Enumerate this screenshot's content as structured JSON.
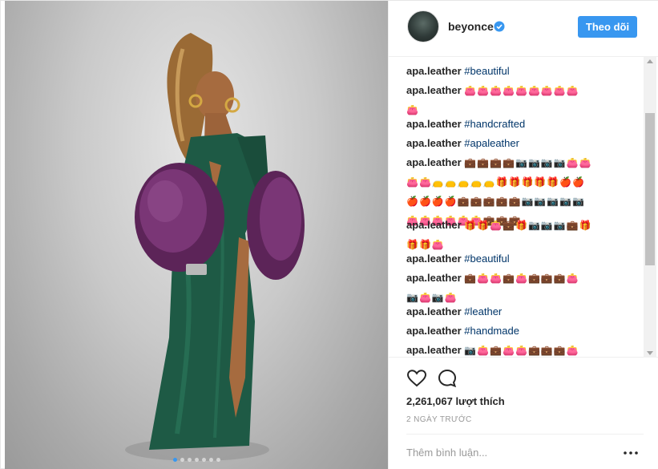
{
  "post": {
    "username": "beyonce",
    "follow_label": "Theo dõi",
    "likes": "2,261,067 lượt thích",
    "time": "2 NGÀY TRƯỚC",
    "comment_placeholder": "Thêm bình luận..."
  },
  "comments": [
    {
      "user": "apa.leather",
      "text": "#beautiful"
    },
    {
      "user": "apa.leather",
      "text": "👛👛👛👛👛👛👛👛👛",
      "text2": "👛"
    },
    {
      "user": "apa.leather",
      "text": "#handcrafted"
    },
    {
      "user": "apa.leather",
      "text": "#apaleather"
    },
    {
      "user": "apa.leather",
      "text": "💼💼💼💼📷📷📷📷👛👛",
      "text2": "👛👛👝👝👝👝👝🎁🎁🎁🎁🎁🍎🍎",
      "text3": "🍎🍎🍎🍎💼💼💼💼💼📷📷📷📷📷",
      "text4": "👛👛👛👛👛👛💼💼💼"
    },
    {
      "user": "apa.leather",
      "text": "🎁🎁👛💼🎁📷📷📷💼🎁",
      "text2": "🎁🎁👛"
    },
    {
      "user": "apa.leather",
      "text": "#beautiful"
    },
    {
      "user": "apa.leather",
      "text": "💼👛👛💼👛💼💼💼👛",
      "text2": "📷👛📷👛"
    },
    {
      "user": "apa.leather",
      "text": "#leather"
    },
    {
      "user": "apa.leather",
      "text": "#handmade"
    },
    {
      "user": "apa.leather",
      "text": "📷👛💼👛👛💼💼💼👛"
    }
  ],
  "icons": {
    "verified": "verified-badge-icon",
    "heart": "heart-icon",
    "comment": "comment-icon",
    "more": "more-options-icon"
  },
  "colors": {
    "accent": "#3897f0",
    "hashtag": "#003569",
    "muted": "#999999"
  },
  "carousel": {
    "total": 7,
    "active": 1
  }
}
